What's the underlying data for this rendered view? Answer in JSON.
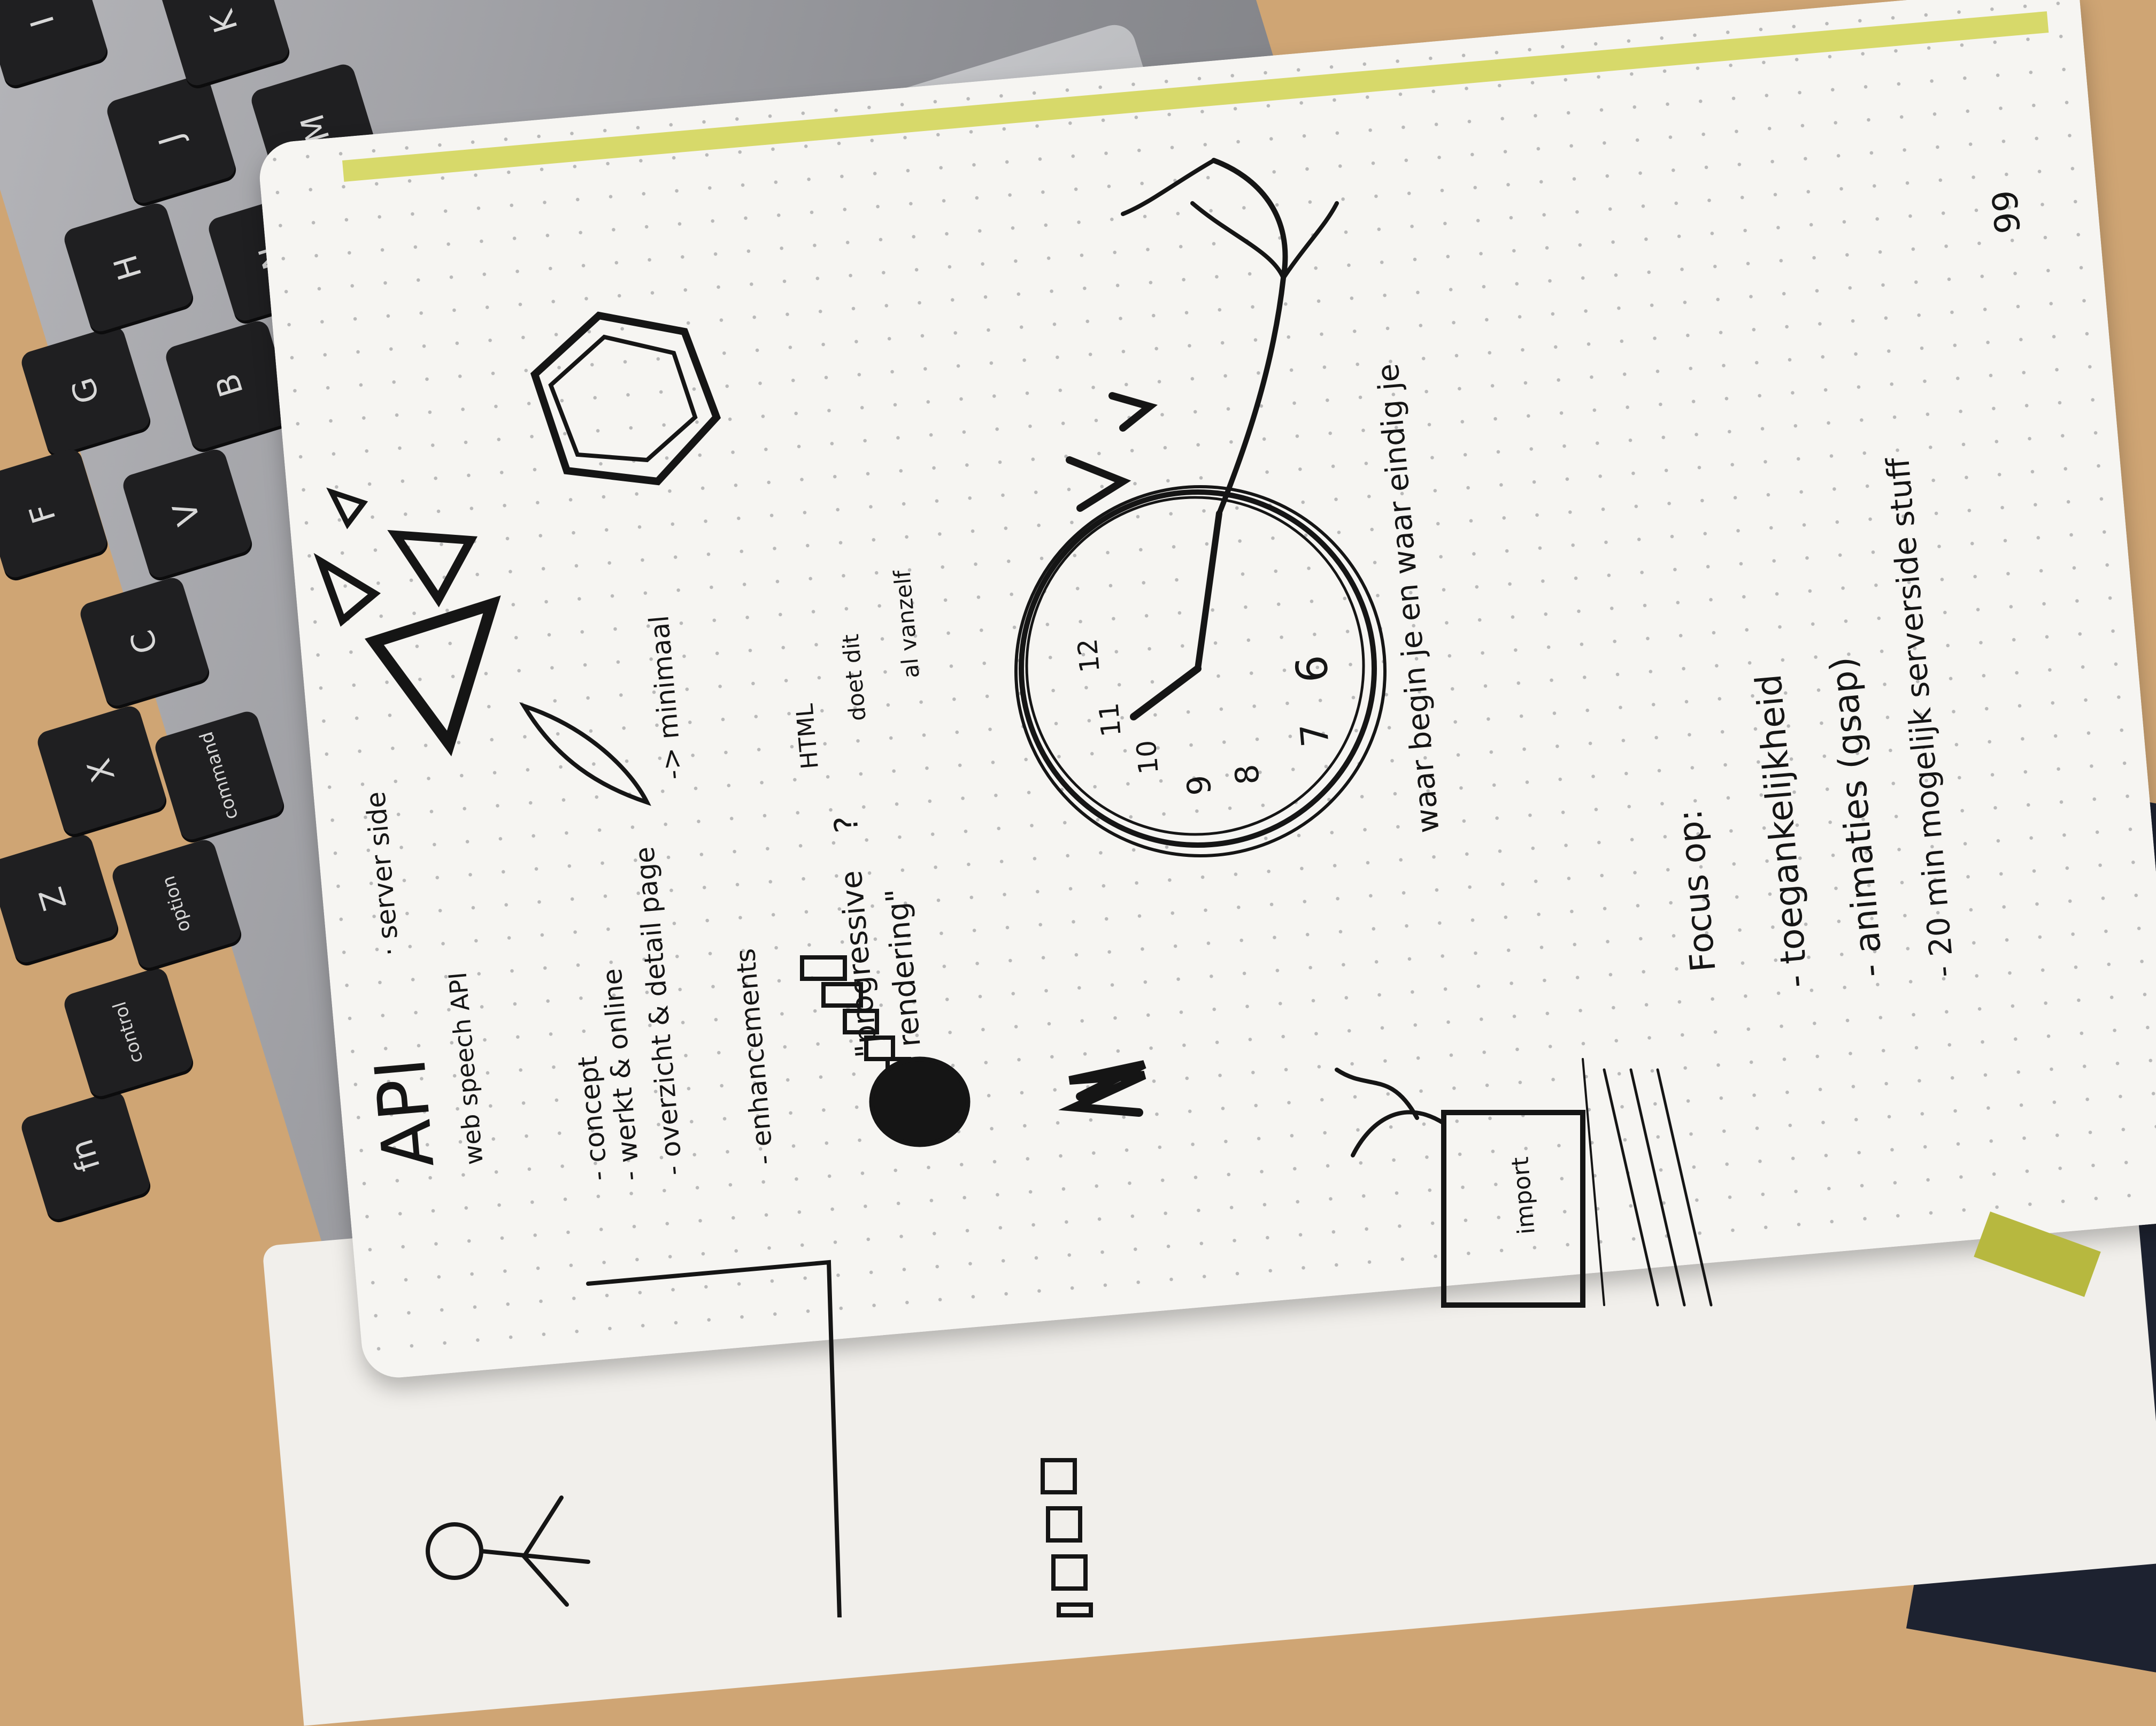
{
  "keyboard": {
    "keys": [
      "fn",
      "control",
      "option",
      "command",
      "Z",
      "X",
      "C",
      "V",
      "B",
      "N",
      "M",
      "G",
      "H",
      "J",
      "K",
      "F",
      "I"
    ]
  },
  "notes": {
    "page_number": "99",
    "title": "API",
    "server_side": "· server side",
    "web_speech": "web speech API",
    "concept": "- concept",
    "werkt_online": "- werkt & online",
    "overzicht": "- overzicht & detail page",
    "minimaal": "-> minimaal",
    "enhancements": "- enhancements",
    "progressive": "\"progressive",
    "rendering": "rendering\"",
    "question": "?",
    "html": "HTML",
    "doet_dit": "doet dit",
    "al_vanzelf": "al vanzelf",
    "waar_begin": "waar begin je en waar eindig je",
    "focus_op": "Focus op:",
    "focus_items": [
      "- toegankelijkheid",
      "- animaties (gsap)",
      "- 20 min mogelijk serverside stuff"
    ],
    "import_label": "import",
    "clock_numbers": [
      "12",
      "11",
      "10",
      "9",
      "8",
      "7",
      "6"
    ]
  },
  "colors": {
    "ink": "#151515",
    "paper": "#f6f5f2",
    "desk": "#cfa574",
    "laptop": "#9c9da1",
    "key": "#1f1f21"
  }
}
